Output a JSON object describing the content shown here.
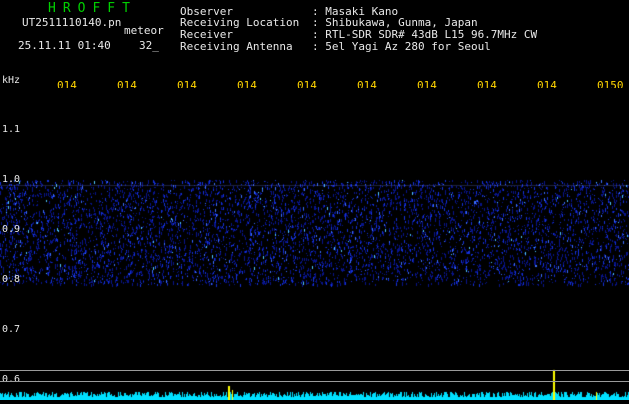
{
  "header": {
    "title": "HROFFT",
    "filename": "UT2511110140.pn",
    "type": "meteor",
    "datetime": "25.11.11 01:40",
    "extra": "32_"
  },
  "info": [
    {
      "label": "Observer",
      "value": ": Masaki Kano"
    },
    {
      "label": "Receiving Location",
      "value": ": Shibukawa, Gunma, Japan"
    },
    {
      "label": "Receiver",
      "value": ": RTL-SDR SDR# 43dB L15 96.7MHz CW"
    },
    {
      "label": "Receiving Antenna",
      "value": ": 5el Yagi Az 280 for Seoul"
    }
  ],
  "spectrogram": {
    "freq_unit": "kHz",
    "time_labels": [
      "014",
      "014",
      "014",
      "014",
      "014",
      "014",
      "014",
      "014",
      "014",
      "0150"
    ],
    "freq_labels": [
      "1.1",
      "1.0",
      "0.9",
      "0.8",
      "0.7",
      "0.6"
    ],
    "noise_band_khz": [
      0.82,
      1.0
    ],
    "colors": {
      "background": "#000000",
      "noise": "#1030d0",
      "signal": "#40c8ff",
      "baseline": "#00e0ff",
      "marker": "#ffff00",
      "time_label": "#ffd400",
      "title": "#00d000"
    }
  }
}
